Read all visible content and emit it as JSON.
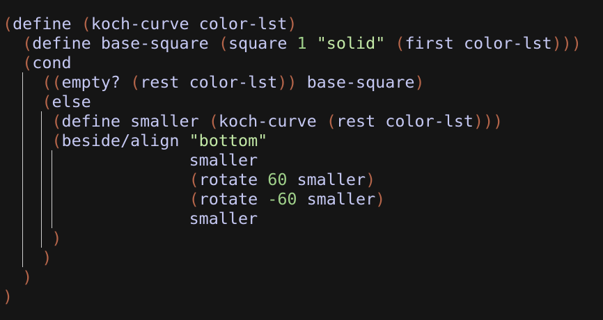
{
  "editor": {
    "lines": [
      [
        {
          "t": "(",
          "c": "paren"
        },
        {
          "t": "define ",
          "c": "ident"
        },
        {
          "t": "(",
          "c": "paren"
        },
        {
          "t": "koch-curve color-lst",
          "c": "ident"
        },
        {
          "t": ")",
          "c": "paren"
        }
      ],
      [
        {
          "t": "  ",
          "c": "ident"
        },
        {
          "t": "(",
          "c": "paren"
        },
        {
          "t": "define base-square ",
          "c": "ident"
        },
        {
          "t": "(",
          "c": "paren"
        },
        {
          "t": "square ",
          "c": "ident"
        },
        {
          "t": "1",
          "c": "num"
        },
        {
          "t": " ",
          "c": "ident"
        },
        {
          "t": "\"solid\"",
          "c": "str"
        },
        {
          "t": " ",
          "c": "ident"
        },
        {
          "t": "(",
          "c": "paren"
        },
        {
          "t": "first color-lst",
          "c": "ident"
        },
        {
          "t": ")))",
          "c": "paren"
        }
      ],
      [
        {
          "t": "  ",
          "c": "ident"
        },
        {
          "t": "(",
          "c": "paren"
        },
        {
          "t": "cond",
          "c": "ident"
        }
      ],
      [
        {
          "t": "    ",
          "c": "ident"
        },
        {
          "t": "((",
          "c": "paren"
        },
        {
          "t": "empty? ",
          "c": "ident"
        },
        {
          "t": "(",
          "c": "paren"
        },
        {
          "t": "rest color-lst",
          "c": "ident"
        },
        {
          "t": "))",
          "c": "paren"
        },
        {
          "t": " base-square",
          "c": "ident"
        },
        {
          "t": ")",
          "c": "paren"
        }
      ],
      [
        {
          "t": "    ",
          "c": "ident"
        },
        {
          "t": "(",
          "c": "paren"
        },
        {
          "t": "else",
          "c": "ident"
        }
      ],
      [
        {
          "t": "     ",
          "c": "ident"
        },
        {
          "t": "(",
          "c": "paren"
        },
        {
          "t": "define smaller ",
          "c": "ident"
        },
        {
          "t": "(",
          "c": "paren"
        },
        {
          "t": "koch-curve ",
          "c": "ident"
        },
        {
          "t": "(",
          "c": "paren"
        },
        {
          "t": "rest color-lst",
          "c": "ident"
        },
        {
          "t": ")))",
          "c": "paren"
        }
      ],
      [
        {
          "t": "     ",
          "c": "ident"
        },
        {
          "t": "(",
          "c": "paren"
        },
        {
          "t": "beside/align ",
          "c": "ident"
        },
        {
          "t": "\"bottom\"",
          "c": "str"
        }
      ],
      [
        {
          "t": "                   smaller",
          "c": "ident"
        }
      ],
      [
        {
          "t": "                   ",
          "c": "ident"
        },
        {
          "t": "(",
          "c": "paren"
        },
        {
          "t": "rotate ",
          "c": "ident"
        },
        {
          "t": "60",
          "c": "num"
        },
        {
          "t": " smaller",
          "c": "ident"
        },
        {
          "t": ")",
          "c": "paren"
        }
      ],
      [
        {
          "t": "                   ",
          "c": "ident"
        },
        {
          "t": "(",
          "c": "paren"
        },
        {
          "t": "rotate ",
          "c": "ident"
        },
        {
          "t": "-60",
          "c": "num"
        },
        {
          "t": " smaller",
          "c": "ident"
        },
        {
          "t": ")",
          "c": "paren"
        }
      ],
      [
        {
          "t": "                   smaller",
          "c": "ident"
        }
      ],
      [
        {
          "t": "     ",
          "c": "ident"
        },
        {
          "t": ")",
          "c": "paren"
        }
      ],
      [
        {
          "t": "    ",
          "c": "ident"
        },
        {
          "t": ")",
          "c": "paren"
        }
      ],
      [
        {
          "t": "  ",
          "c": "ident"
        },
        {
          "t": ")",
          "c": "paren"
        }
      ],
      [
        {
          "t": ")",
          "c": "paren"
        }
      ]
    ]
  }
}
